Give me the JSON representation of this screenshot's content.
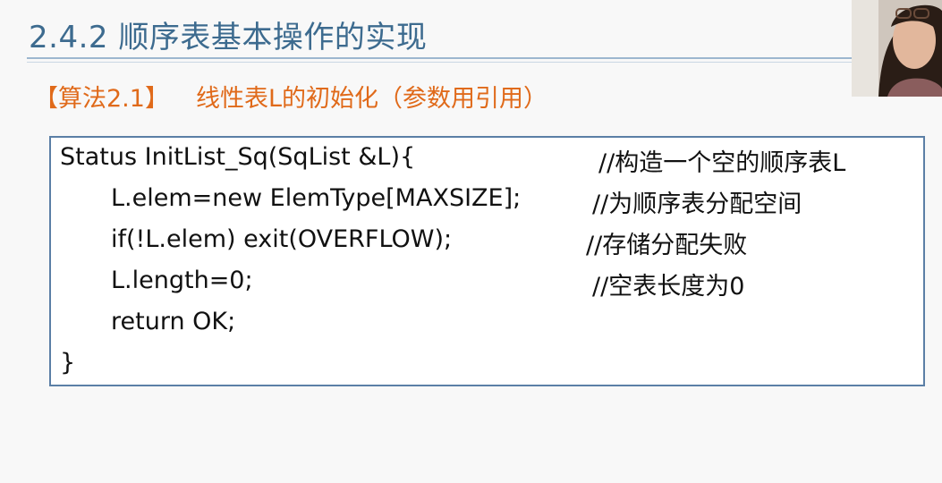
{
  "slide": {
    "title": "2.4.2 顺序表基本操作的实现"
  },
  "algorithm": {
    "tag": "【算法2.1】",
    "title": "线性表L的初始化（参数用引用）"
  },
  "code": {
    "lines": [
      {
        "code": "Status InitList_Sq(SqList &L){",
        "comment": "//构造一个空的顺序表L"
      },
      {
        "code": "L.elem=new ElemType[MAXSIZE];",
        "comment": "//为顺序表分配空间"
      },
      {
        "code": "if(!L.elem) exit(OVERFLOW);",
        "comment": "//存储分配失败"
      },
      {
        "code": "L.length=0;",
        "comment": "//空表长度为0"
      },
      {
        "code": "return OK;",
        "comment": ""
      },
      {
        "code": "}",
        "comment": ""
      }
    ]
  },
  "colors": {
    "title": "#3d6b8f",
    "algorithm": "#e06a1a",
    "code_border": "#5b7fa6"
  }
}
